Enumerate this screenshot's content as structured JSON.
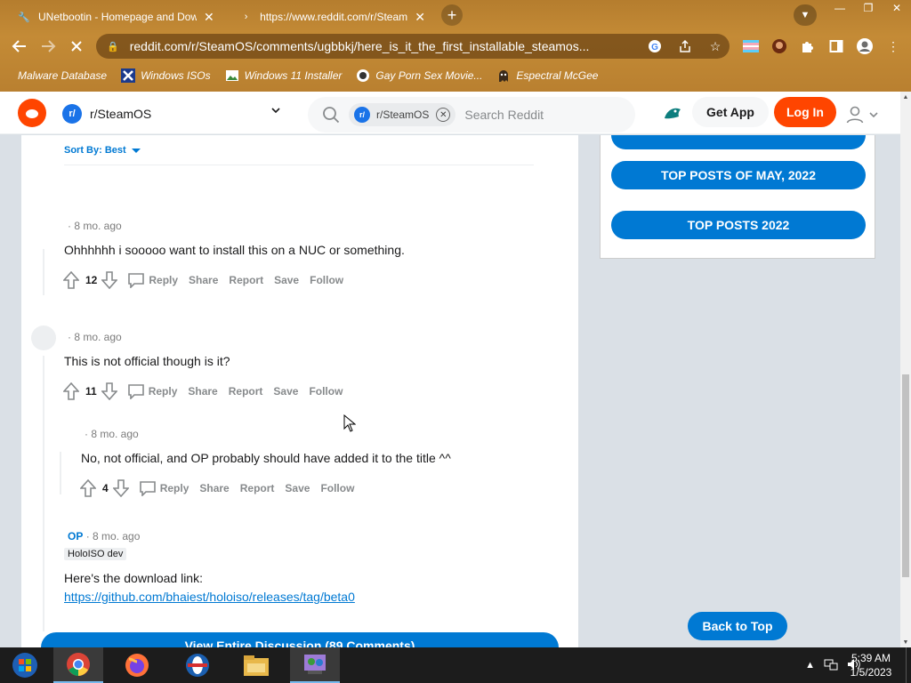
{
  "browser": {
    "tabs": [
      {
        "title": "UNetbootin - Homepage and Dow",
        "close": "✕"
      },
      {
        "title": "https://www.reddit.com/r/Steam",
        "close": "✕"
      }
    ],
    "new_tab": "+",
    "url": "reddit.com/r/SteamOS/comments/ugbbkj/here_is_it_the_first_installable_steamos...",
    "bookmarks": [
      {
        "label": "Malware Database"
      },
      {
        "label": "Windows ISOs"
      },
      {
        "label": "Windows 11 Installer"
      },
      {
        "label": "Gay Porn Sex Movie..."
      },
      {
        "label": "Espectral McGee"
      }
    ],
    "window_controls": [
      "—",
      "❐",
      "✕"
    ]
  },
  "reddit_header": {
    "subreddit": "r/SteamOS",
    "search_chip": "r/SteamOS",
    "search_placeholder": "Search Reddit",
    "get_app": "Get App",
    "log_in": "Log In"
  },
  "sort": {
    "label": "Sort By: Best"
  },
  "comments": [
    {
      "time": "· 8 mo. ago",
      "body": "Ohhhhhh i sooooo want to install this on a NUC or something.",
      "score": "12"
    },
    {
      "time": "· 8 mo. ago",
      "body": "This is not official though is it?",
      "score": "11"
    },
    {
      "time": "· 8 mo. ago",
      "body": "No, not official, and OP probably should have added it to the title ^^",
      "score": "4"
    },
    {
      "op_label": "OP",
      "time": "· 8 mo. ago",
      "flair": "HoloISO dev",
      "body": "Here's the download link:",
      "link": "https://github.com/bhaiest/holoiso/releases/tag/beta0"
    }
  ],
  "actions": {
    "reply": "Reply",
    "share": "Share",
    "report": "Report",
    "save": "Save",
    "follow": "Follow"
  },
  "view_all": "View Entire Discussion (89 Comments)",
  "sidebar": {
    "buttons": [
      "TOP POSTS OF MAY, 2022",
      "TOP POSTS 2022"
    ]
  },
  "back_to_top": "Back to Top",
  "taskbar": {
    "time": "5:39 AM",
    "date": "1/5/2023"
  }
}
